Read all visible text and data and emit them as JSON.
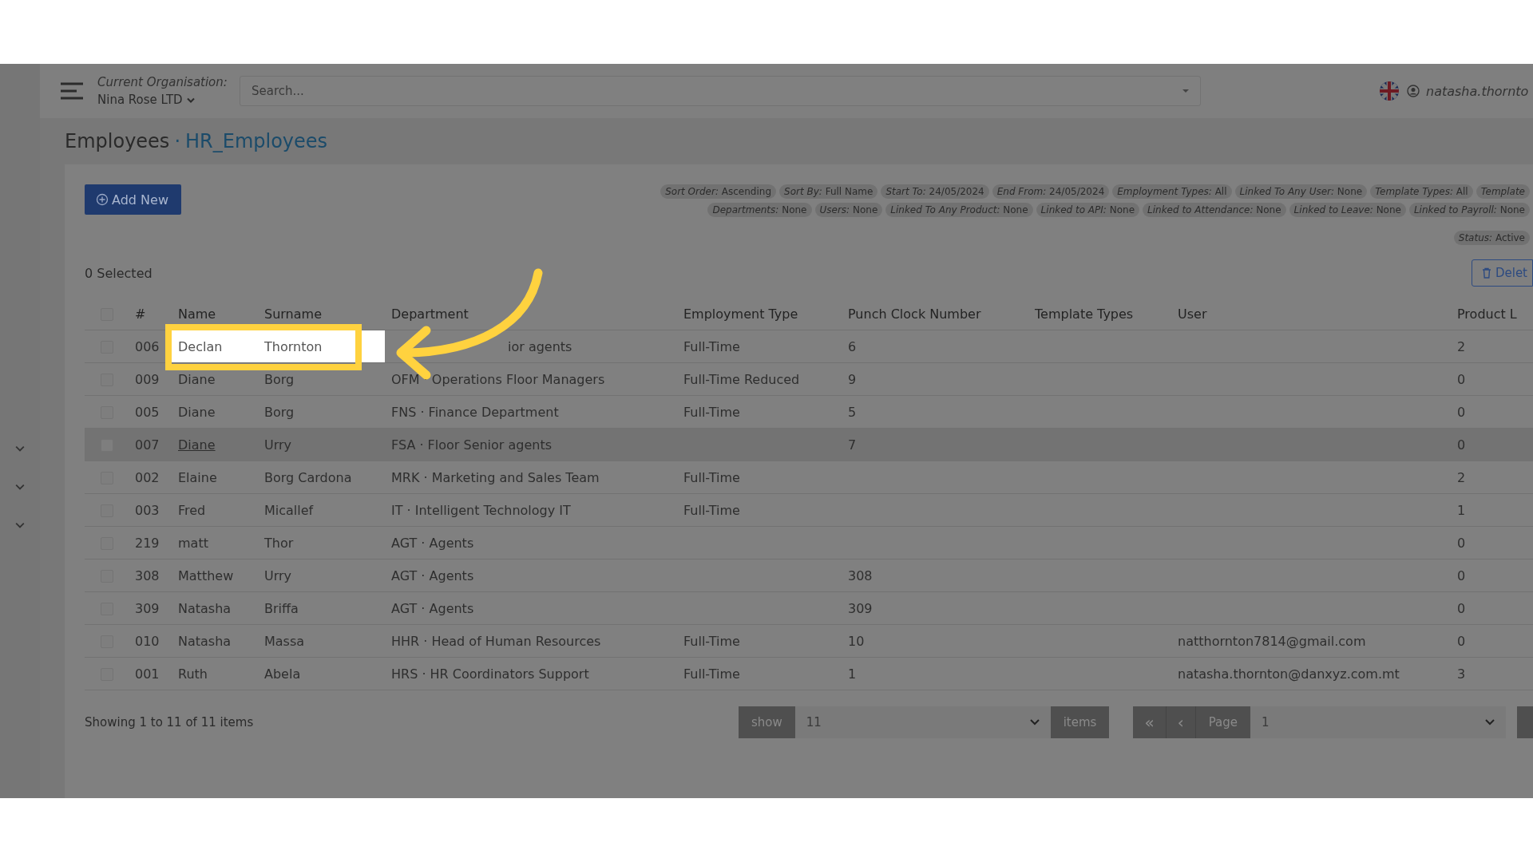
{
  "topbar": {
    "org_label": "Current Organisation:",
    "org_name": "Nina Rose LTD",
    "search": {
      "placeholder": "Search..."
    },
    "username": "natasha.thornto"
  },
  "select_all": {
    "checked": false
  },
  "title": {
    "section": "Employees",
    "separator": "·",
    "view": "HR_Employees"
  },
  "add_button": "Add New",
  "filter_rows": [
    [
      {
        "label": "Sort Order:",
        "value": "Ascending"
      },
      {
        "label": "Sort By:",
        "value": "Full Name"
      },
      {
        "label": "Start To:",
        "value": "24/05/2024"
      },
      {
        "label": "End From:",
        "value": "24/05/2024"
      },
      {
        "label": "Employment Types:",
        "value": "All"
      },
      {
        "label": "Linked To Any User:",
        "value": "None"
      },
      {
        "label": "Template Types:",
        "value": "All"
      },
      {
        "label": "Template"
      }
    ],
    [
      {
        "label": "Departments:",
        "value": "None"
      },
      {
        "label": "Users:",
        "value": "None"
      },
      {
        "label": "Linked To Any Product:",
        "value": "None"
      },
      {
        "label": "Linked to API:",
        "value": "None"
      },
      {
        "label": "Linked to Attendance:",
        "value": "None"
      },
      {
        "label": "Linked to Leave:",
        "value": "None"
      },
      {
        "label": "Linked to Payroll:",
        "value": "None"
      }
    ],
    [
      {
        "label": "Status:",
        "value": "Active"
      }
    ]
  ],
  "selected_count": "0 Selected",
  "delete_button": "Delet",
  "table": {
    "columns": [
      "#",
      "Name",
      "Surname",
      "Department",
      "Employment Type",
      "Punch Clock Number",
      "Template Types",
      "User",
      "Product L"
    ],
    "rows": [
      {
        "id": "006",
        "name": "Declan",
        "surname": "Thornton",
        "department": "ior agents",
        "employment": "Full-Time",
        "punch": "6",
        "template": "",
        "user": "",
        "product": "2",
        "checked": false,
        "highlighted": true,
        "hovered": false
      },
      {
        "id": "009",
        "name": "Diane",
        "surname": "Borg",
        "department": "OFM · Operations Floor Managers",
        "employment": "Full-Time Reduced",
        "punch": "9",
        "template": "",
        "user": "",
        "product": "0",
        "checked": false,
        "highlighted": false,
        "hovered": false
      },
      {
        "id": "005",
        "name": "Diane",
        "surname": "Borg",
        "department": "FNS · Finance Department",
        "employment": "Full-Time",
        "punch": "5",
        "template": "",
        "user": "",
        "product": "0",
        "checked": false,
        "highlighted": false,
        "hovered": false
      },
      {
        "id": "007",
        "name": "Diane",
        "surname": "Urry",
        "department": "FSA · Floor Senior agents",
        "employment": "",
        "punch": "7",
        "template": "",
        "user": "",
        "product": "0",
        "checked": false,
        "highlighted": false,
        "hovered": true
      },
      {
        "id": "002",
        "name": "Elaine",
        "surname": "Borg Cardona",
        "department": "MRK · Marketing and Sales Team",
        "employment": "Full-Time",
        "punch": "",
        "template": "",
        "user": "",
        "product": "2",
        "checked": false,
        "highlighted": false,
        "hovered": false
      },
      {
        "id": "003",
        "name": "Fred",
        "surname": "Micallef",
        "department": "IT · Intelligent Technology IT",
        "employment": "Full-Time",
        "punch": "",
        "template": "",
        "user": "",
        "product": "1",
        "checked": false,
        "highlighted": false,
        "hovered": false
      },
      {
        "id": "219",
        "name": "matt",
        "surname": "Thor",
        "department": "AGT · Agents",
        "employment": "",
        "punch": "",
        "template": "",
        "user": "",
        "product": "0",
        "checked": false,
        "highlighted": false,
        "hovered": false
      },
      {
        "id": "308",
        "name": "Matthew",
        "surname": "Urry",
        "department": "AGT · Agents",
        "employment": "",
        "punch": "308",
        "template": "",
        "user": "",
        "product": "0",
        "checked": false,
        "highlighted": false,
        "hovered": false
      },
      {
        "id": "309",
        "name": "Natasha",
        "surname": "Briffa",
        "department": "AGT · Agents",
        "employment": "",
        "punch": "309",
        "template": "",
        "user": "",
        "product": "0",
        "checked": false,
        "highlighted": false,
        "hovered": false
      },
      {
        "id": "010",
        "name": "Natasha",
        "surname": "Massa",
        "department": "HHR · Head of Human Resources",
        "employment": "Full-Time",
        "punch": "10",
        "template": "",
        "user": "natthornton7814@gmail.com",
        "product": "0",
        "checked": false,
        "highlighted": false,
        "hovered": false
      },
      {
        "id": "001",
        "name": "Ruth",
        "surname": "Abela",
        "department": "HRS · HR Coordinators Support",
        "employment": "Full-Time",
        "punch": "1",
        "template": "",
        "user": "natasha.thornton@danxyz.com.mt",
        "product": "3",
        "checked": false,
        "highlighted": false,
        "hovered": false
      }
    ]
  },
  "footer": {
    "summary": "Showing 1 to 11 of 11 items",
    "show_label": "show",
    "show_value": "11",
    "items_label": "items",
    "first_page": "«",
    "prev_page": "‹",
    "page_label": "Page",
    "page_value": "1"
  }
}
